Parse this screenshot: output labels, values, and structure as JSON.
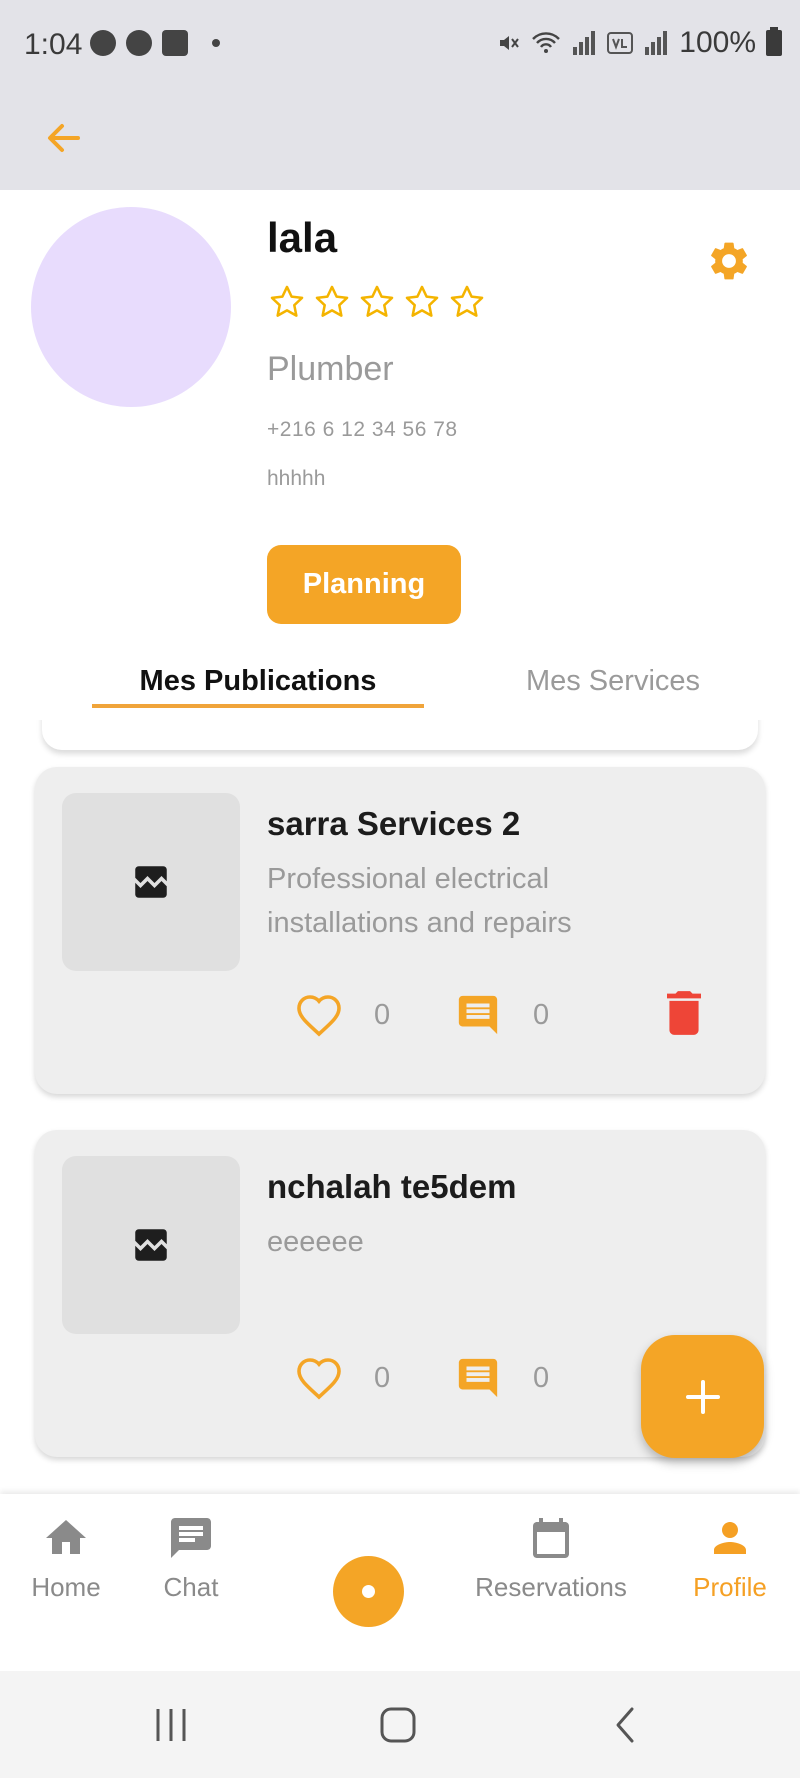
{
  "status_bar": {
    "time": "1:04",
    "battery_text": "100%",
    "icons": [
      "messenger-icon",
      "snapchat-icon",
      "gallery-icon",
      "mute-icon",
      "wifi-icon",
      "signal-icon",
      "volte-icon",
      "battery-icon"
    ]
  },
  "profile": {
    "name": "lala",
    "rating": 0,
    "max_rating": 5,
    "profession": "Plumber",
    "phone": "+216 6 12 34 56 78",
    "bio": "hhhhh",
    "planning_label": "Planning",
    "avatar_color": "#e8dcfd"
  },
  "tabs": {
    "publications": "Mes Publications",
    "services": "Mes Services"
  },
  "posts": [
    {
      "title": "sarra Services 2",
      "description": "Professional electrical installations and repairs",
      "likes": "0",
      "comments": "0"
    },
    {
      "title": "nchalah te5dem",
      "description": "eeeeee",
      "likes": "0",
      "comments": "0"
    }
  ],
  "bottom_nav": {
    "home": "Home",
    "chat": "Chat",
    "reservations": "Reservations",
    "profile": "Profile"
  },
  "colors": {
    "accent": "#f4a526",
    "delete": "#ee4537",
    "app_bar": "#e3e3e8"
  }
}
